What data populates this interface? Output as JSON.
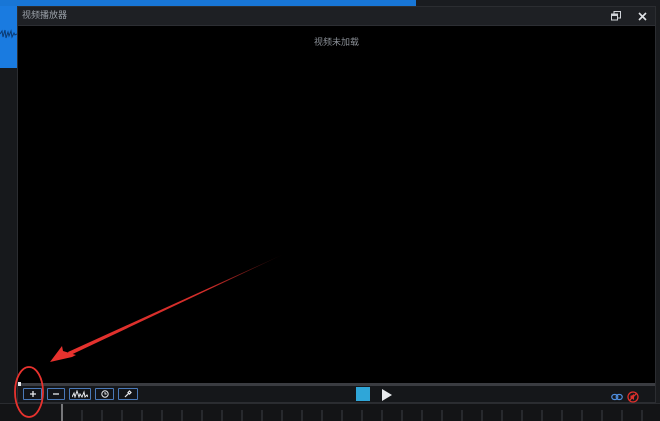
{
  "window": {
    "title": "视频播放器",
    "restore_label": "restore",
    "close_label": "close"
  },
  "video": {
    "status_text": "视频未加载"
  },
  "controls": {
    "progress": 0.0,
    "buttons": [
      {
        "name": "add-button",
        "icon": "plus-icon"
      },
      {
        "name": "remove-button",
        "icon": "minus-icon"
      },
      {
        "name": "waveform-button",
        "icon": "waveform-icon"
      },
      {
        "name": "clock-button",
        "icon": "clock-icon"
      },
      {
        "name": "tools-button",
        "icon": "wrench-icon"
      }
    ],
    "transport": {
      "stop_icon": "stop-icon",
      "play_icon": "play-icon"
    },
    "right_icons": [
      "link-icon",
      "mute-icon"
    ]
  },
  "colors": {
    "accent_blue": "#1a7be0",
    "stop_button": "#2fa6d8",
    "button_border": "#4a79b8",
    "annotation_red": "#e8322e"
  }
}
